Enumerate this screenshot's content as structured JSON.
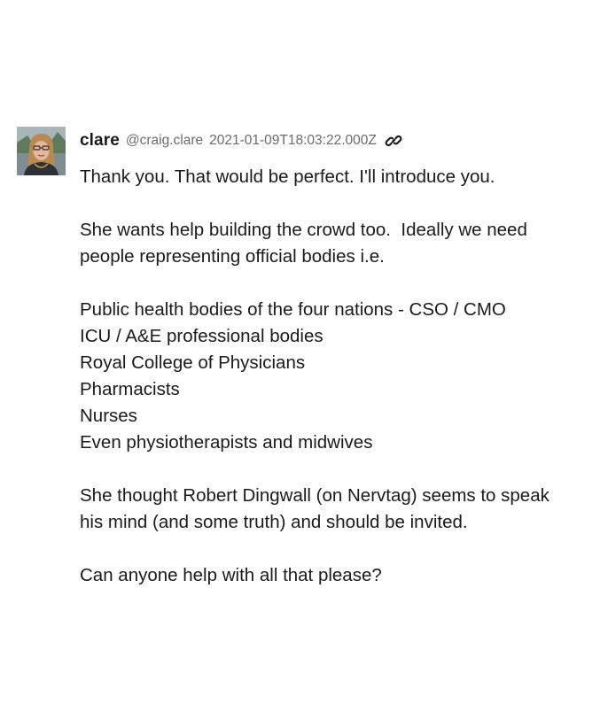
{
  "post": {
    "author": {
      "display_name": "clare",
      "handle": "@craig.clare",
      "avatar_icon": "user-avatar"
    },
    "timestamp": "2021-01-09T18:03:22.000Z",
    "permalink_icon": "link-icon",
    "paragraphs": [
      [
        "Thank you. That would be perfect. I'll introduce you."
      ],
      [
        "She wants help building the crowd too.  Ideally we need",
        "people representing official bodies i.e."
      ],
      [
        "Public health bodies of the four nations - CSO / CMO",
        "ICU / A&E professional bodies",
        "Royal College of Physicians",
        "Pharmacists",
        "Nurses",
        "Even physiotherapists and midwives"
      ],
      [
        "She thought Robert Dingwall (on Nervtag) seems to speak",
        "his mind (and some truth) and should be invited."
      ],
      [
        "Can anyone help with all that please?"
      ]
    ]
  }
}
